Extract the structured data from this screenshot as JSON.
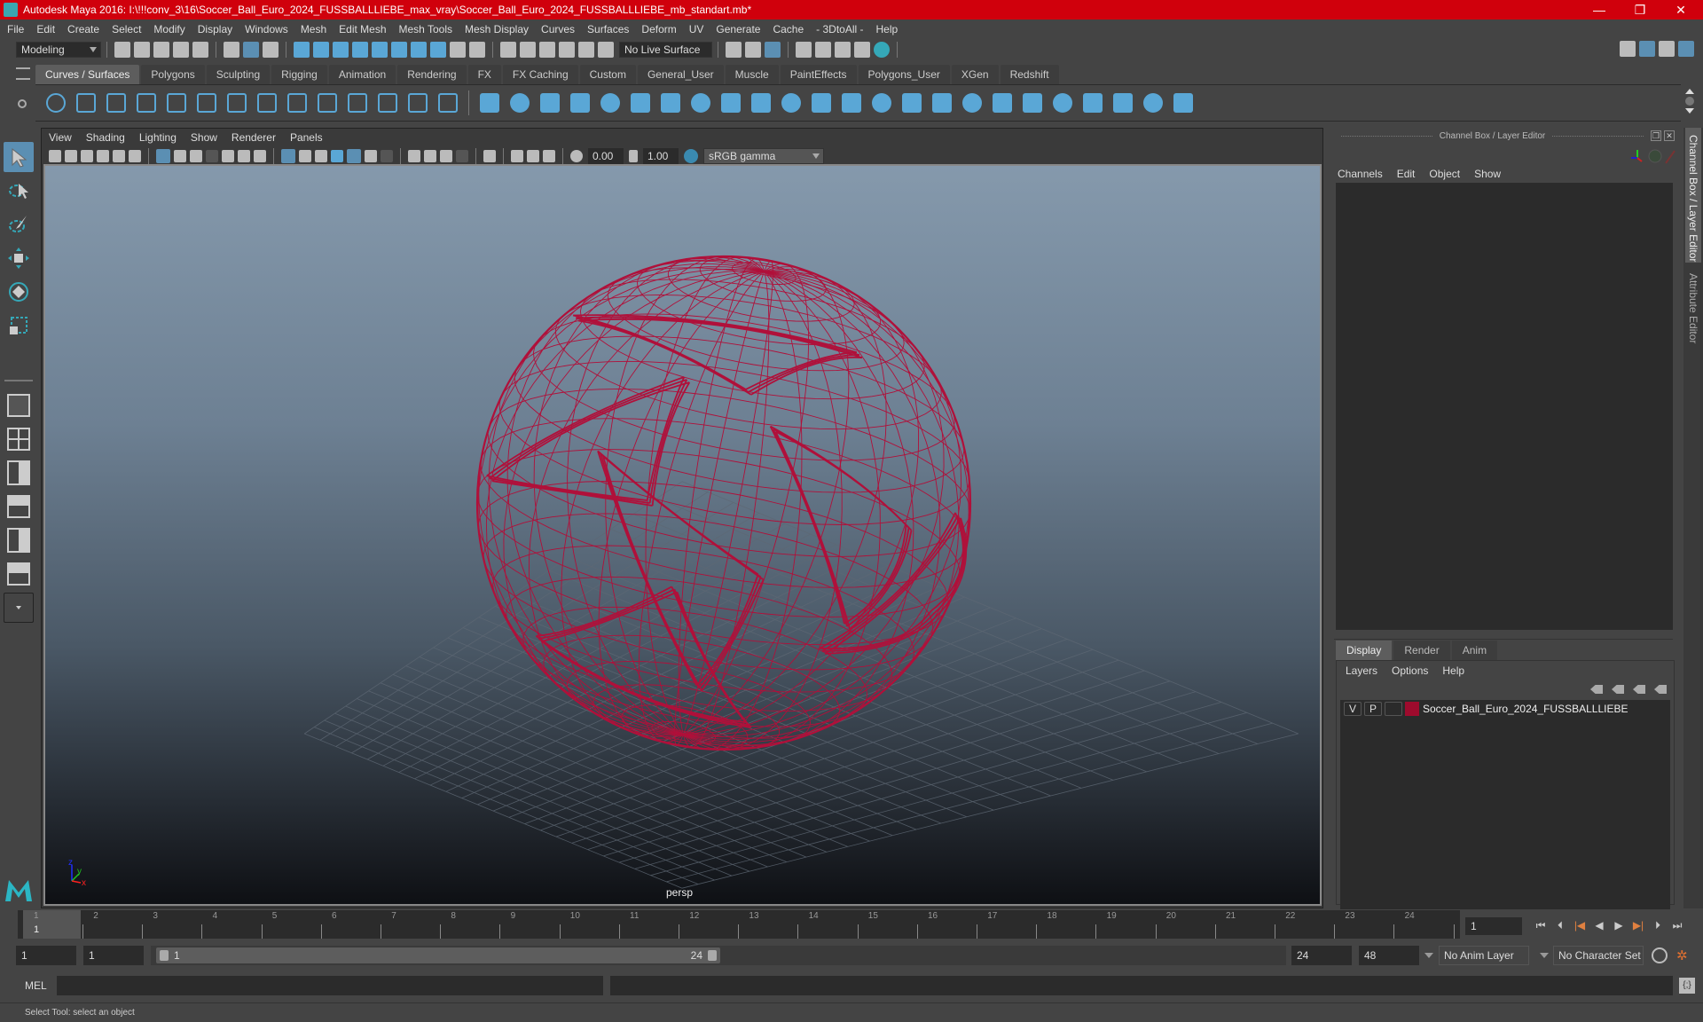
{
  "window": {
    "title": "Autodesk Maya 2016: I:\\!!!conv_3\\16\\Soccer_Ball_Euro_2024_FUSSBALLLIEBE_max_vray\\Soccer_Ball_Euro_2024_FUSSBALLLIEBE_mb_standart.mb*",
    "minimize": "—",
    "restore": "❐",
    "close": "✕"
  },
  "menubar": [
    "File",
    "Edit",
    "Create",
    "Select",
    "Modify",
    "Display",
    "Windows",
    "Mesh",
    "Edit Mesh",
    "Mesh Tools",
    "Mesh Display",
    "Curves",
    "Surfaces",
    "Deform",
    "UV",
    "Generate",
    "Cache",
    "- 3DtoAll -",
    "Help"
  ],
  "statusline": {
    "mode": "Modeling",
    "live_surface": "No Live Surface"
  },
  "shelf": {
    "tabs": [
      "Curves / Surfaces",
      "Polygons",
      "Sculpting",
      "Rigging",
      "Animation",
      "Rendering",
      "FX",
      "FX Caching",
      "Custom",
      "General_User",
      "Muscle",
      "PaintEffects",
      "Polygons_User",
      "XGen",
      "Redshift"
    ],
    "active_tab": "Curves / Surfaces",
    "icons": [
      "nurbs-circle",
      "nurbs-square",
      "cv-curve",
      "pencil-curve",
      "arc-tool",
      "ep-curve",
      "cut-curve",
      "curve-point",
      "extend-curve",
      "offset-curve",
      "rebuild-curve",
      "attach-curve",
      "bezier-curve",
      "insert-knot",
      "nurbs-sphere",
      "nurbs-cube",
      "nurbs-cylinder",
      "nurbs-cone",
      "nurbs-plane",
      "nurbs-torus",
      "revolve",
      "loft",
      "planar",
      "extrude",
      "birail",
      "boundary",
      "square-surface",
      "bevel",
      "project-curve",
      "trim",
      "untrim",
      "intersect",
      "attach-surface",
      "detach-surface",
      "open-close",
      "align-surface",
      "sculpt-geometry",
      "sculpt-surface"
    ]
  },
  "viewport": {
    "menu": [
      "View",
      "Shading",
      "Lighting",
      "Show",
      "Renderer",
      "Panels"
    ],
    "exposure": "0.00",
    "gamma": "1.00",
    "color_space": "sRGB gamma",
    "camera_label": "persp",
    "axis_labels": {
      "x": "x",
      "y": "y",
      "z": "z"
    },
    "wireframe_color": "#b0103a"
  },
  "channel_box": {
    "title": "Channel Box / Layer Editor",
    "menu": [
      "Channels",
      "Edit",
      "Object",
      "Show"
    ]
  },
  "layer_editor": {
    "tabs": [
      "Display",
      "Render",
      "Anim"
    ],
    "active_tab": "Display",
    "menu": [
      "Layers",
      "Options",
      "Help"
    ],
    "layers": [
      {
        "visible": "V",
        "playback": "P",
        "color": "#9e0b2d",
        "name": "Soccer_Ball_Euro_2024_FUSSBALLLIEBE"
      }
    ]
  },
  "side_tabs": [
    "Channel Box / Layer Editor",
    "Attribute Editor"
  ],
  "timeline": {
    "ticks": [
      "1",
      "2",
      "3",
      "4",
      "5",
      "6",
      "7",
      "8",
      "9",
      "10",
      "11",
      "12",
      "13",
      "14",
      "15",
      "16",
      "17",
      "18",
      "19",
      "20",
      "21",
      "22",
      "23",
      "24"
    ],
    "current_frame_marker": "1",
    "current_frame": "1"
  },
  "range": {
    "start": "1",
    "playback_start": "1",
    "range_start_label": "1",
    "range_end_label": "24",
    "playback_end": "24",
    "end": "48",
    "anim_layer": "No Anim Layer",
    "character_set": "No Character Set"
  },
  "command": {
    "label": "MEL"
  },
  "help_line": "Select Tool: select an object"
}
